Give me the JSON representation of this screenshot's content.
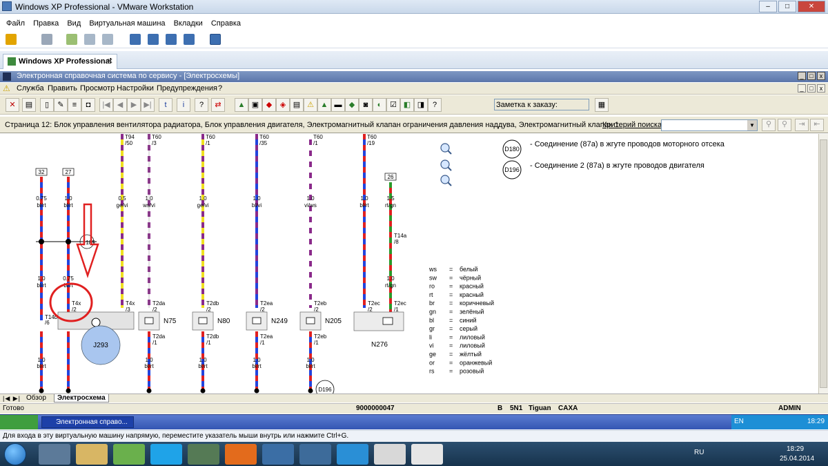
{
  "vmware": {
    "title": "Windows XP Professional - VMware Workstation",
    "menu": [
      "Файл",
      "Правка",
      "Вид",
      "Виртуальная машина",
      "Вкладки",
      "Справка"
    ],
    "tab": "Windows XP Professional"
  },
  "app": {
    "title": "Электронная справочная система по сервису - [Электросхемы]",
    "menu": [
      "Служба",
      "Править",
      "Просмотр",
      "Настройки",
      "Предупреждения",
      "?"
    ],
    "note_label": "Заметка к заказу:",
    "page_text": "Страница 12: Блок управления вентилятора радиатора, Блок управления двигателя, Электромагнитный клапан ограничения давления наддува, Электромагнитный клапан 1",
    "search_label": "Критерий поиска:"
  },
  "schematic": {
    "top_refs": [
      {
        "t": "T94",
        "b": "/50"
      },
      {
        "t": "T60",
        "b": "/3"
      },
      {
        "t": "T60",
        "b": "/1"
      },
      {
        "t": "T60",
        "b": "/35"
      },
      {
        "t": "T60",
        "b": "/1"
      },
      {
        "t": "T60",
        "b": "/19"
      }
    ],
    "numbers": [
      "32",
      "27",
      "26"
    ],
    "wires_top": [
      {
        "size": "0.75",
        "color": "bl/rt"
      },
      {
        "size": "1.0",
        "color": "bl/rt"
      },
      {
        "size": "0.5",
        "color": "ge/vi"
      },
      {
        "size": "1.0",
        "color": "ws/vi"
      },
      {
        "size": "1.0",
        "color": "ge/vi"
      },
      {
        "size": "1.0",
        "color": "bl/vi"
      },
      {
        "size": "1.0",
        "color": "vi/ws"
      },
      {
        "size": "1.0",
        "color": "bl/rt"
      },
      {
        "size": "1.5",
        "color": "rt/gn"
      }
    ],
    "wires_mid": [
      {
        "size": "1.0",
        "color": "bl/rt"
      },
      {
        "size": "0.75",
        "color": "bl/rt"
      },
      {
        "size": "1.0",
        "color": "rt/gn"
      }
    ],
    "wires_bottom": [
      {
        "size": "1.0",
        "color": "bl/rt"
      },
      {
        "size": "1.0",
        "color": "bl/rt"
      },
      {
        "size": "1.0",
        "color": "bl/rt"
      },
      {
        "size": "1.0",
        "color": "bl/rt"
      },
      {
        "size": "1.0",
        "color": "bl/rt"
      }
    ],
    "connectors": [
      {
        "t": "T14b",
        "b": "/6"
      },
      {
        "t": "T4x",
        "b": "/2"
      },
      {
        "t": "T4x",
        "b": "/3"
      },
      {
        "t": "T2da",
        "b": "/2"
      },
      {
        "t": "T2db",
        "b": "/2"
      },
      {
        "t": "T2ea",
        "b": "/2"
      },
      {
        "t": "T2eb",
        "b": "/2"
      },
      {
        "t": "T2ec",
        "b": "/2"
      },
      {
        "t": "T2ec",
        "b": "/1"
      },
      {
        "t": "T14a",
        "b": "/8"
      },
      {
        "t": "T2da",
        "b": "/1"
      },
      {
        "t": "T2db",
        "b": "/1"
      },
      {
        "t": "T2ea",
        "b": "/1"
      },
      {
        "t": "T2eb",
        "b": "/1"
      }
    ],
    "components": [
      "N75",
      "N80",
      "N249",
      "N205",
      "N276",
      "J293"
    ],
    "circle_185": "185",
    "d180": {
      "label": "D180",
      "text": "Соединение (87a) в жгуте проводов моторного отсека"
    },
    "d196": {
      "label": "D196",
      "text": "Соединение 2 (87a) в жгуте проводов двигателя"
    },
    "d196_bottom": "D196",
    "legend": [
      {
        "code": "ws",
        "name": "белый"
      },
      {
        "code": "sw",
        "name": "чёрный"
      },
      {
        "code": "ro",
        "name": "красный"
      },
      {
        "code": "rt",
        "name": "красный"
      },
      {
        "code": "br",
        "name": "коричневый"
      },
      {
        "code": "gn",
        "name": "зелёный"
      },
      {
        "code": "bl",
        "name": "синий"
      },
      {
        "code": "gr",
        "name": "серый"
      },
      {
        "code": "li",
        "name": "лиловый"
      },
      {
        "code": "vi",
        "name": "лиловый"
      },
      {
        "code": "ge",
        "name": "жёлтый"
      },
      {
        "code": "or",
        "name": "оранжевый"
      },
      {
        "code": "rs",
        "name": "розовый"
      }
    ]
  },
  "sheet_tabs": [
    "Обзор",
    "Электросхема"
  ],
  "status": {
    "ready": "Готово",
    "code": "9000000047",
    "b": "B",
    "c1": "5N1",
    "model": "Tiguan",
    "engine": "CAXA",
    "user": "ADMIN"
  },
  "guest_taskbar": {
    "item": "Электронная справо...",
    "lang": "EN",
    "time": "18:29"
  },
  "vm_hint": "Для входа в эту виртуальную машину напрямую, переместите указатель мыши внутрь или нажмите Ctrl+G.",
  "host": {
    "lang": "RU",
    "time": "18:29",
    "date": "25.04.2014"
  },
  "colors": {
    "bl": "#2244dd",
    "rt": "#e02020",
    "ge": "#f0e020",
    "vi": "#8a2a8a",
    "ws": "#ffffff",
    "gn": "#2a9a2a",
    "annot": "#e02020",
    "j293": "#a9c6ef"
  }
}
